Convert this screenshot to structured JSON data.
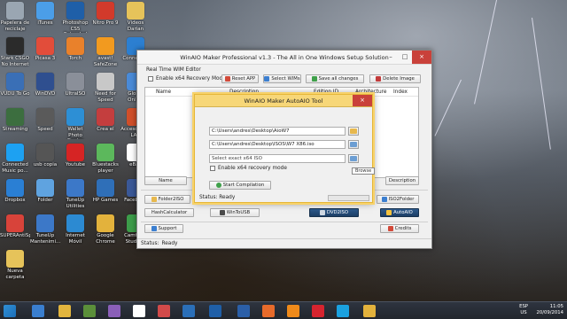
{
  "desktop": {
    "icons": [
      {
        "label": "Papelera de reciclaje",
        "color": "#9aa6b2"
      },
      {
        "label": "iTunes",
        "color": "#4b9ee8"
      },
      {
        "label": "Photoshop CS5 Extended",
        "color": "#1f5fa8"
      },
      {
        "label": "Nitro Pro 9",
        "color": "#d23a2b"
      },
      {
        "label": "Vídeos Darian",
        "color": "#e6c35a"
      },
      {
        "label": "Stark CSGO No Internet",
        "color": "#2b2b2b"
      },
      {
        "label": "Picasa 3",
        "color": "#e24d3a"
      },
      {
        "label": "Torch",
        "color": "#e9812b"
      },
      {
        "label": "avast! SafeZone",
        "color": "#f29a1f"
      },
      {
        "label": "Connectify",
        "color": "#2c7fd1"
      },
      {
        "label": "VUDU To Go",
        "color": "#3a6fb6"
      },
      {
        "label": "WinDVD",
        "color": "#2f4f8f"
      },
      {
        "label": "UltraISO",
        "color": "#8a8f99"
      },
      {
        "label": "Need for Speed",
        "color": "#c8c8c8"
      },
      {
        "label": "Global Online",
        "color": "#4a8bd8"
      },
      {
        "label": "Streaming",
        "color": "#3c6e3f"
      },
      {
        "label": "Speed",
        "color": "#5a5a5a"
      },
      {
        "label": "Wallet Photo Center",
        "color": "#2d8fd5"
      },
      {
        "label": "Crea el",
        "color": "#c43e3e"
      },
      {
        "label": "Acceso a CS LAN",
        "color": "#d14f2a"
      },
      {
        "label": "Connected Music po...",
        "color": "#1da1f2"
      },
      {
        "label": "usb copia",
        "color": "#555555"
      },
      {
        "label": "Youtube",
        "color": "#d62424"
      },
      {
        "label": "Bluestacks player",
        "color": "#5cb85c"
      },
      {
        "label": "eBay",
        "color": "#ffffff"
      },
      {
        "label": "Dropbox",
        "color": "#2a7fd4"
      },
      {
        "label": "Folder",
        "color": "#5fa3e0"
      },
      {
        "label": "TuneUp Utilities",
        "color": "#3c78c8"
      },
      {
        "label": "HP Games",
        "color": "#2f6fb8"
      },
      {
        "label": "Facebook",
        "color": "#3b5998"
      },
      {
        "label": "SUPERAntiSpyware",
        "color": "#d8433a"
      },
      {
        "label": "TuneUp Mantenimi...",
        "color": "#3c78c8"
      },
      {
        "label": "Internet Móvil",
        "color": "#2c8ad2"
      },
      {
        "label": "Google Chrome",
        "color": "#e3b23c"
      },
      {
        "label": "Camtasia Studio 8",
        "color": "#3d9d4a"
      },
      {
        "label": "Nueva carpeta",
        "color": "#e6c35a"
      }
    ]
  },
  "main_window": {
    "title": "WinAIO Maker Professional v1.3 - The All in One Windows Setup Solution",
    "section_label": "Real Time WIM Editor",
    "enable_x64_label": "Enable x64 Recovery Mode",
    "buttons": {
      "reset": "Reset APP",
      "select_wims": "Select WIMs",
      "save_all": "Save all changes",
      "delete_image": "Delete Image",
      "name": "Name",
      "description": "Description",
      "folder2iso": "Folder2ISO",
      "iso2folder": "ISO2Folder",
      "hash_calculator": "HashCalculator",
      "wintousb": "WinToUSB",
      "dvd2iso": "DVD2ISO",
      "autoaio": "AutoAIO",
      "support": "Support",
      "credits": "Credits"
    },
    "columns": [
      "Name",
      "Description",
      "Edition ID",
      "Architecture",
      "Index"
    ],
    "status_label": "Status:",
    "status_value": "Ready"
  },
  "dialog": {
    "title": "WinAIO Maker AutoAIO Tool",
    "path1": "C:\\Users\\andres\\Desktop\\AioW7",
    "path2": "C:\\Users\\andres\\Desktop\\ISOS\\W7 X86.iso",
    "path3_placeholder": "Select exact x64 ISO",
    "enable_x64_label": "Enable x64 recovery mode",
    "start_button": "Start Compilation",
    "browse_tooltip": "Browse",
    "status_label": "Status:",
    "status_value": "Ready"
  },
  "taskbar": {
    "items": [
      "start",
      "internet-explorer",
      "file-explorer",
      "store",
      "media",
      "hp",
      "calendar",
      "paint",
      "photoshop",
      "word",
      "app",
      "vlc",
      "opera",
      "skype",
      "chrome"
    ],
    "lang_top": "ESP",
    "lang_bottom": "US",
    "time": "11:05",
    "date": "20/09/2014"
  }
}
